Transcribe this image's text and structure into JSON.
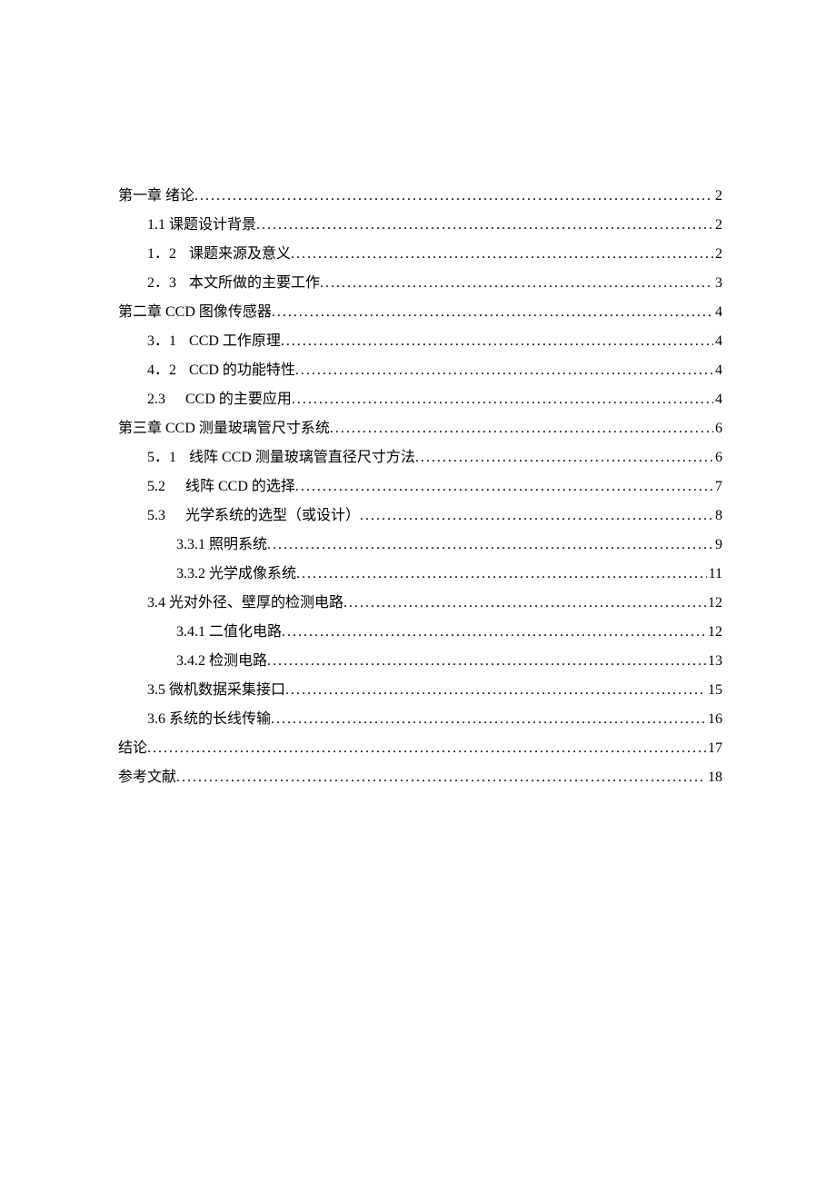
{
  "toc": [
    {
      "indent": 0,
      "label": "第一章 绪论",
      "page": "2"
    },
    {
      "indent": 1,
      "label": "1.1 课题设计背景",
      "page": "2"
    },
    {
      "indent": 1,
      "num": "1．2",
      "label": "课题来源及意义",
      "page": "2"
    },
    {
      "indent": 1,
      "num": "2．3",
      "label": "本文所做的主要工作",
      "page": "3"
    },
    {
      "indent": 0,
      "label": "第二章 CCD 图像传感器",
      "page": "4"
    },
    {
      "indent": 1,
      "num": "3．1",
      "label": "CCD 工作原理",
      "page": "4"
    },
    {
      "indent": 1,
      "num": "4．2",
      "label": "CCD 的功能特性",
      "page": "4"
    },
    {
      "indent": 1,
      "num": "2.3",
      "bigGap": true,
      "label": "CCD 的主要应用",
      "page": "4"
    },
    {
      "indent": 0,
      "label": "第三章 CCD 测量玻璃管尺寸系统",
      "page": "6"
    },
    {
      "indent": 1,
      "num": "5．1",
      "label": "线阵 CCD 测量玻璃管直径尺寸方法",
      "page": "6"
    },
    {
      "indent": 1,
      "num": "5.2",
      "bigGap": true,
      "label": "线阵 CCD 的选择",
      "page": "7"
    },
    {
      "indent": 1,
      "num": "5.3",
      "bigGap": true,
      "label": "光学系统的选型（或设计）",
      "page": "8"
    },
    {
      "indent": 2,
      "label": "3.3.1 照明系统",
      "page": "9"
    },
    {
      "indent": 2,
      "label": "3.3.2 光学成像系统",
      "page": "11"
    },
    {
      "indent": 1,
      "label": "3.4 光对外径、壁厚的检测电路",
      "page": "12"
    },
    {
      "indent": 2,
      "label": "3.4.1 二值化电路",
      "page": "12"
    },
    {
      "indent": 2,
      "label": "3.4.2 检测电路",
      "page": "13"
    },
    {
      "indent": 1,
      "label": "3.5 微机数据采集接口",
      "page": "15"
    },
    {
      "indent": 1,
      "label": "3.6 系统的长线传输",
      "page": "16"
    },
    {
      "indent": 0,
      "label": "结论",
      "page": "17"
    },
    {
      "indent": 0,
      "label": "参考文献",
      "page": "18"
    }
  ]
}
